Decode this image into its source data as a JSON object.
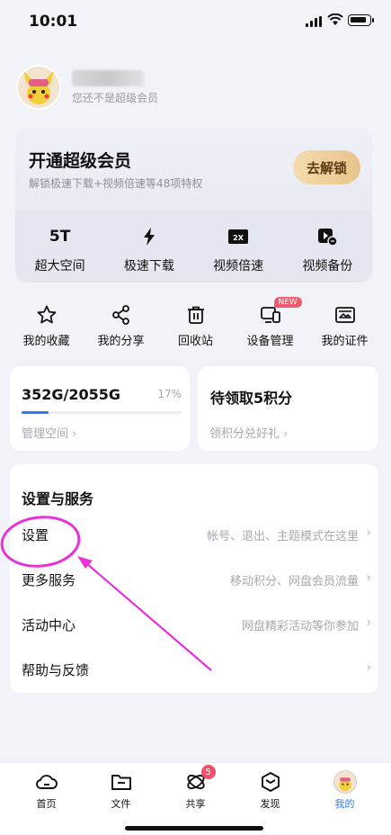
{
  "status_bar": {
    "time": "10:01"
  },
  "profile": {
    "vip_status": "您还不是超级会员"
  },
  "vip_card": {
    "title": "开通超级会员",
    "subtitle": "解锁极速下载+视频倍速等48项特权",
    "unlock_label": "去解锁",
    "perks": [
      {
        "icon": "5T",
        "label": "超大空间"
      },
      {
        "icon": "lightning-icon",
        "label": "极速下载"
      },
      {
        "icon": "speed-2x-icon",
        "label": "视频倍速"
      },
      {
        "icon": "video-backup-icon",
        "label": "视频备份"
      }
    ]
  },
  "shortcuts": [
    {
      "icon": "star-icon",
      "label": "我的收藏"
    },
    {
      "icon": "share-icon",
      "label": "我的分享"
    },
    {
      "icon": "trash-icon",
      "label": "回收站"
    },
    {
      "icon": "device-icon",
      "label": "设备管理",
      "badge": "NEW"
    },
    {
      "icon": "id-card-icon",
      "label": "我的证件"
    }
  ],
  "storage": {
    "value": "352G/2055G",
    "percent_text": "17%",
    "fill_fraction": 0.17,
    "link": "管理空间"
  },
  "points": {
    "title": "待领取5积分",
    "link": "领积分兑好礼"
  },
  "settings": {
    "title": "设置与服务",
    "rows": [
      {
        "label": "设置",
        "hint": "帐号、退出、主题模式在这里"
      },
      {
        "label": "更多服务",
        "hint": "移动积分、网盘会员流量"
      },
      {
        "label": "活动中心",
        "hint": "网盘精彩活动等你参加"
      },
      {
        "label": "帮助与反馈",
        "hint": ""
      }
    ]
  },
  "tabs": [
    {
      "icon": "cloud-home-icon",
      "label": "首页"
    },
    {
      "icon": "folder-icon",
      "label": "文件"
    },
    {
      "icon": "share-orbit-icon",
      "label": "共享",
      "badge": "5"
    },
    {
      "icon": "discover-icon",
      "label": "发现"
    },
    {
      "icon": "avatar-icon",
      "label": "我的"
    }
  ],
  "colors": {
    "accent": "#2c7cf6",
    "badge": "#f0506a",
    "annotation": "#e832d8",
    "gold": "#e8c48c"
  }
}
